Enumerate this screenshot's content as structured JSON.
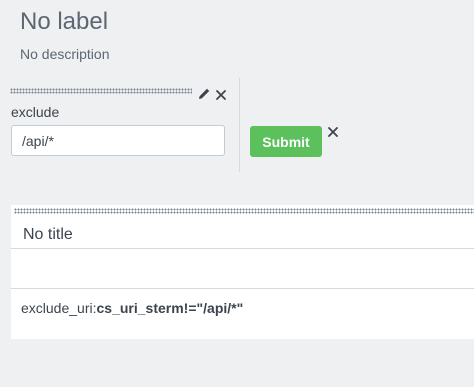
{
  "dashboard": {
    "title": "No label",
    "description": "No description"
  },
  "input_panel": {
    "label": "exclude",
    "value": "/api/*",
    "edit_icon": "pencil-icon",
    "close_icon": "close-icon"
  },
  "submit": {
    "label": "Submit",
    "color": "#5cc05c",
    "close_icon": "close-icon"
  },
  "result_panel": {
    "title": "No title",
    "text_prefix": "exclude_uri:",
    "text_bold": "cs_uri_sterm!=\"/api/*\""
  }
}
